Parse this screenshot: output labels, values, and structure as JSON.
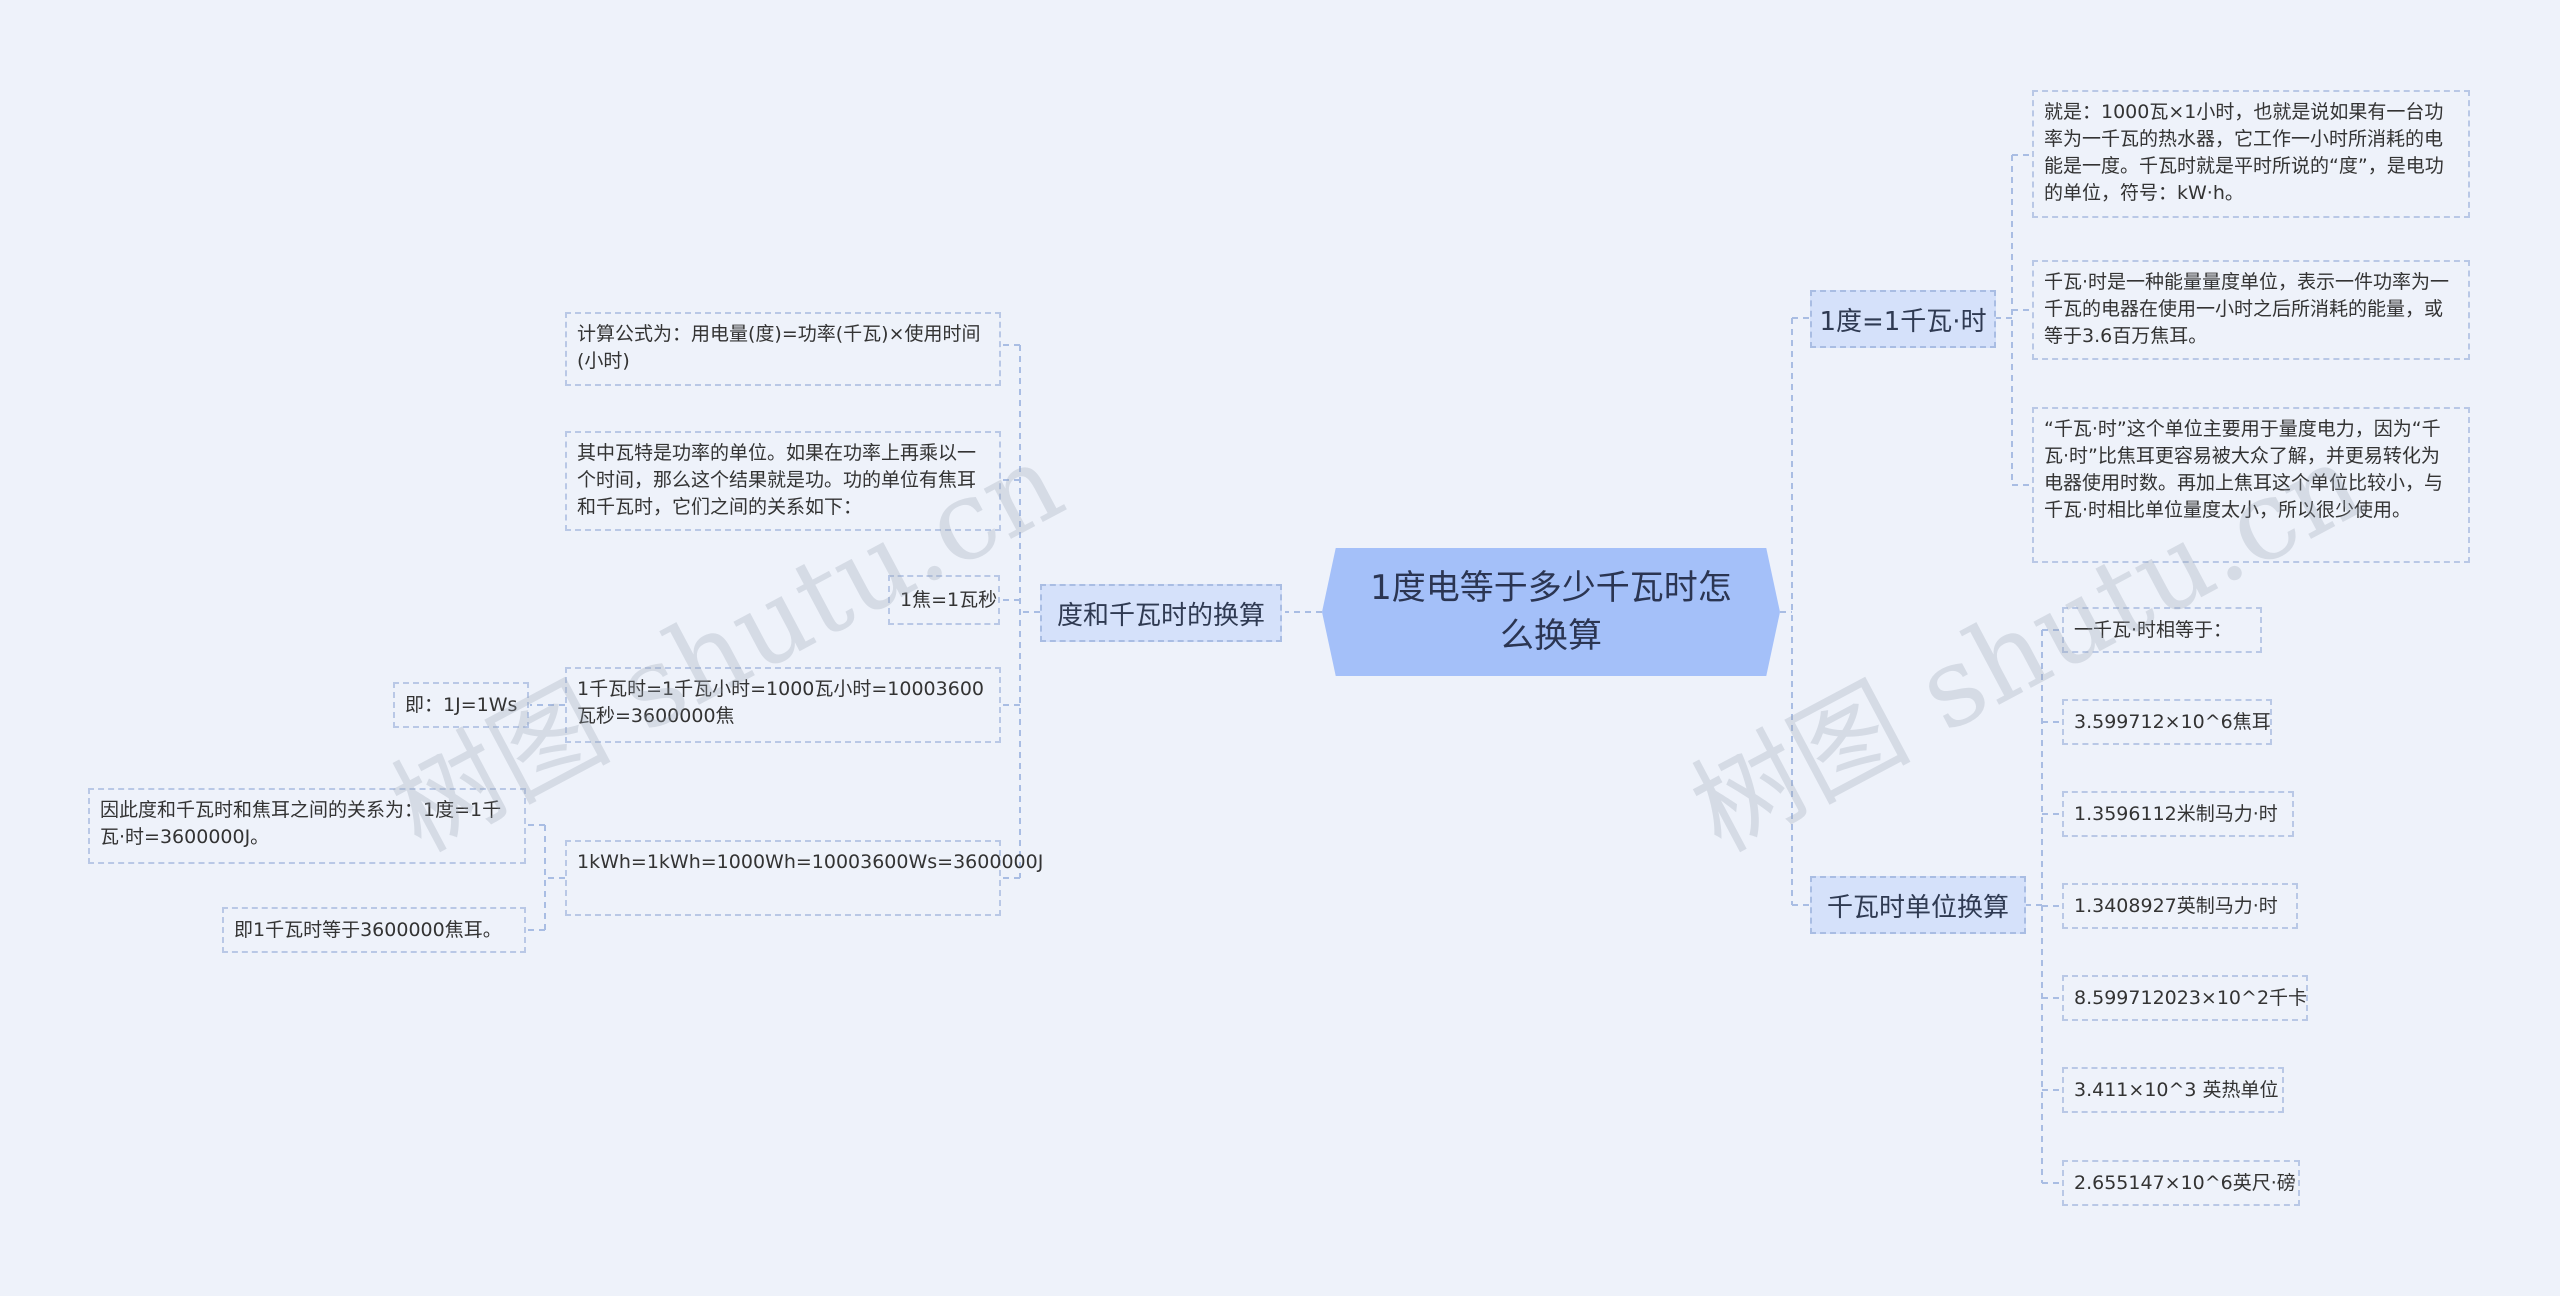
{
  "root": {
    "title": "1度电等于多少千瓦时怎么换算"
  },
  "left_branch": {
    "title": "度和千瓦时的换算",
    "items": [
      "计算公式为：用电量(度)=功率(千瓦)×使用时间(小时)",
      "其中瓦特是功率的单位。如果在功率上再乘以一个时间，那么这个结果就是功。功的单位有焦耳和千瓦时，它们之间的关系如下：",
      "1焦=1瓦秒",
      "1千瓦时=1千瓦小时=1000瓦小时=10003600瓦秒=3600000焦",
      "1kWh=1kWh=1000Wh=10003600Ws=3600000J"
    ],
    "sub_1j": "即：1J=1Ws",
    "sub_relation": "因此度和千瓦时和焦耳之间的关系为：1度=1千瓦·时=3600000J。",
    "sub_equals": "即1千瓦时等于3600000焦耳。"
  },
  "right_branch_1": {
    "title": "1度=1千瓦·时",
    "items": [
      "就是：1000瓦×1小时，也就是说如果有一台功率为一千瓦的热水器，它工作一小时所消耗的电能是一度。千瓦时就是平时所说的“度”，是电功的单位，符号：kW·h。",
      "千瓦·时是一种能量量度单位，表示一件功率为一千瓦的电器在使用一小时之后所消耗的能量，或等于3.6百万焦耳。",
      "“千瓦·时”这个单位主要用于量度电力，因为“千瓦·时”比焦耳更容易被大众了解，并更易转化为电器使用时数。再加上焦耳这个单位比较小，与千瓦·时相比单位量度太小，所以很少使用。"
    ]
  },
  "right_branch_2": {
    "title": "千瓦时单位换算",
    "items": [
      "一千瓦·时相等于：",
      "3.599712×10^6焦耳",
      "1.3596112米制马力·时",
      "1.3408927英制马力·时",
      "8.599712023×10^2千卡",
      "3.411×10^3 英热单位",
      "2.655147×10^6英尺·磅"
    ]
  },
  "watermarks": [
    "树图 shutu.cn",
    "树图 shutu.cn"
  ]
}
